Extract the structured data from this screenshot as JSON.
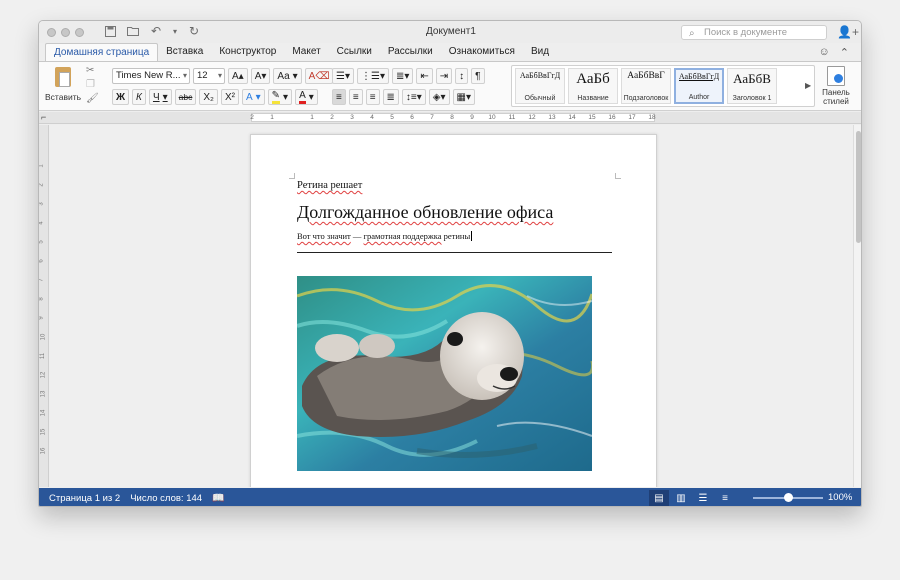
{
  "window": {
    "title": "Документ1",
    "search_placeholder": "Поиск в документе"
  },
  "icons": {
    "search": "search-icon",
    "add_user": "add-user-icon",
    "save": "save-icon",
    "open": "open-folder-icon",
    "undo": "undo-icon",
    "redo": "redo-icon",
    "paste": "clipboard-icon",
    "cut": "scissors-icon",
    "format_painter": "brush-icon",
    "style_pane": "style-pane-icon",
    "smiley": "smiley-icon",
    "collapse": "chevron-up-icon",
    "spell_check": "book-check-icon"
  },
  "tabs": [
    {
      "label": "Домашняя страница",
      "active": true
    },
    {
      "label": "Вставка"
    },
    {
      "label": "Конструктор"
    },
    {
      "label": "Макет"
    },
    {
      "label": "Ссылки"
    },
    {
      "label": "Рассылки"
    },
    {
      "label": "Ознакомиться"
    },
    {
      "label": "Вид"
    }
  ],
  "ribbon": {
    "paste_label": "Вставить",
    "font_name": "Times New R...",
    "font_size": "12",
    "bold": "Ж",
    "italic": "К",
    "underline": "Ч",
    "strike": "abc",
    "subscript": "X₂",
    "superscript": "X²",
    "grow_font": "A▴",
    "shrink_font": "A▾",
    "change_case": "Aa",
    "text_effects": "A",
    "highlight": "✎",
    "font_color": "A",
    "styles": [
      {
        "preview": "АаБбВвГгД",
        "name": "Обычный"
      },
      {
        "preview": "АаБб",
        "name": "Название"
      },
      {
        "preview": "АаБбВвГ",
        "name": "Подзаголовок"
      },
      {
        "preview": "АаБбВвГгД",
        "name": "Author",
        "selected": true
      },
      {
        "preview": "АаБбВ",
        "name": "Заголовок 1"
      }
    ],
    "style_pane_label": "Панель стилей"
  },
  "ruler": {
    "labels": [
      "2",
      "1",
      "",
      "1",
      "2",
      "3",
      "4",
      "5",
      "6",
      "7",
      "8",
      "9",
      "10",
      "11",
      "12",
      "13",
      "14",
      "15",
      "16",
      "17",
      "18"
    ],
    "vertical_labels": [
      "1",
      "2",
      "3",
      "4",
      "5",
      "6",
      "7",
      "8",
      "9",
      "10",
      "11",
      "12",
      "13",
      "14",
      "15",
      "16"
    ]
  },
  "document": {
    "heading": "Ретина решает",
    "title": "Долгожданное обновление офиса",
    "subtitle_parts": [
      "Вот что значит",
      " — ",
      "грамотная поддержка",
      " ретины"
    ],
    "image_alt": "Выдра плывёт на спине в бирюзовой воде"
  },
  "status": {
    "page": "Страница 1 из 2",
    "words": "Число слов: 144",
    "zoom": "100%",
    "zoom_value": 1.0
  },
  "colors": {
    "accent": "#2a5699",
    "active_tab_text": "#2a5aa8",
    "spell_error": "#e04040"
  }
}
